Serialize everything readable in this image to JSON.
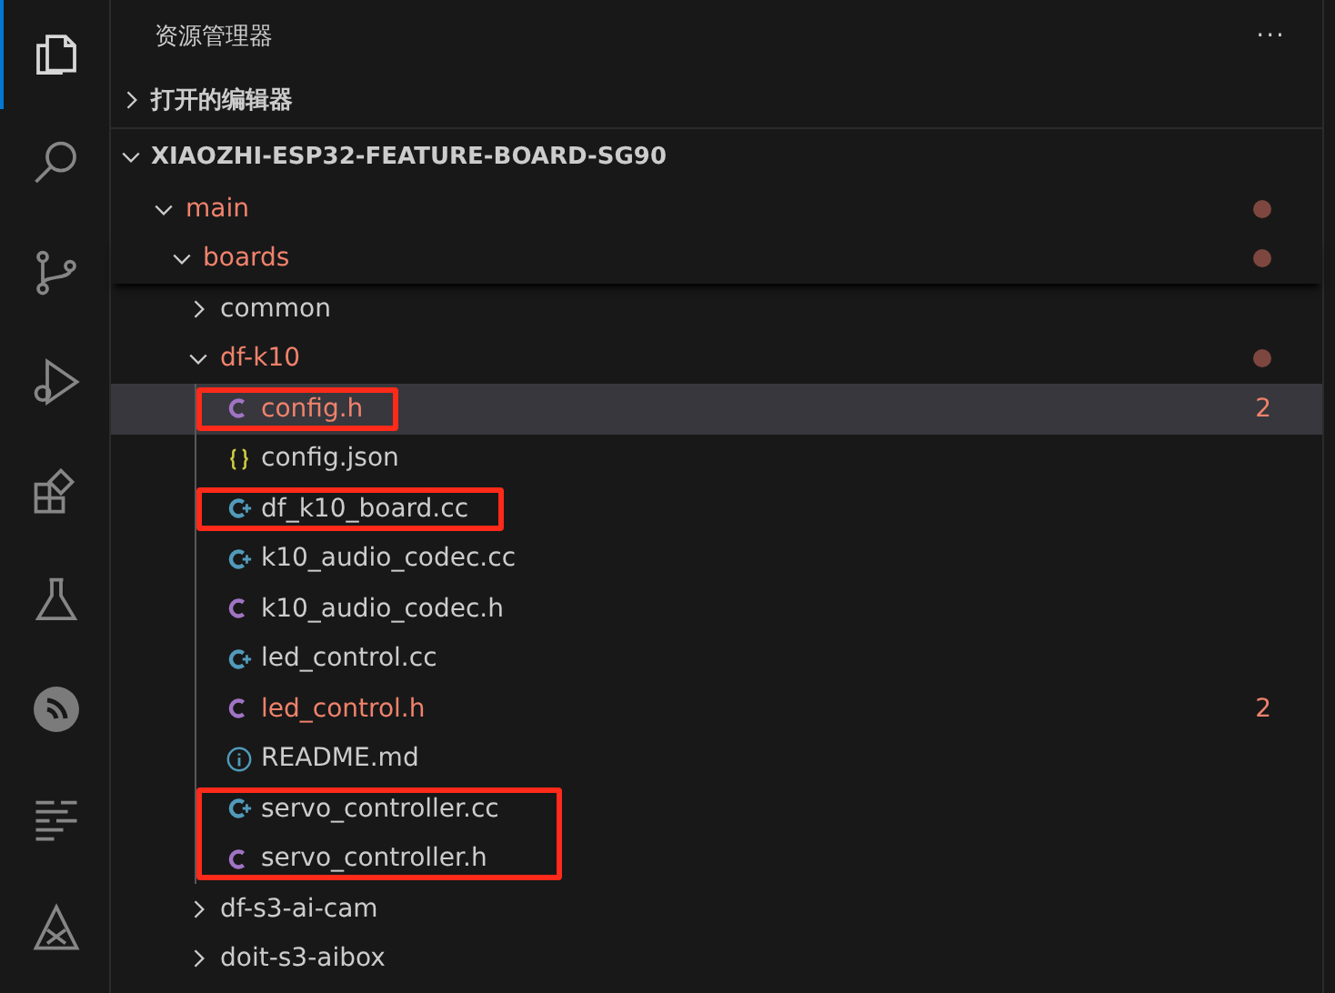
{
  "activity_bar": [
    {
      "kind": "files",
      "selected": true
    },
    {
      "kind": "search",
      "selected": false
    },
    {
      "kind": "branch",
      "selected": false
    },
    {
      "kind": "debug",
      "selected": false
    },
    {
      "kind": "blocks",
      "selected": false
    },
    {
      "kind": "flask",
      "selected": false
    },
    {
      "kind": "signal",
      "selected": false
    },
    {
      "kind": "list",
      "selected": false
    },
    {
      "kind": "triangle",
      "selected": false
    }
  ],
  "explorer": {
    "title": "资源管理器",
    "more": "···",
    "open_editors": {
      "label": "打开的编辑器",
      "expanded": false
    },
    "project": {
      "name": "XIAOZHI-ESP32-FEATURE-BOARD-SG90",
      "expanded": true,
      "children": [
        {
          "name": "main",
          "expanded": true,
          "modified": true,
          "children": [
            {
              "name": "boards",
              "expanded": true,
              "modified": true,
              "children": [
                {
                  "name": "common",
                  "expanded": false,
                  "modified": false
                },
                {
                  "name": "df-k10",
                  "expanded": true,
                  "modified": true,
                  "children": [
                    {
                      "name": "config.h",
                      "kind": "c",
                      "modified": true,
                      "badge": "2",
                      "selected": true,
                      "boxed": true
                    },
                    {
                      "name": "config.json",
                      "kind": "json",
                      "modified": false,
                      "selected": false,
                      "boxed": false
                    },
                    {
                      "name": "df_k10_board.cc",
                      "kind": "cpp",
                      "modified": false,
                      "selected": false,
                      "boxed": true
                    },
                    {
                      "name": "k10_audio_codec.cc",
                      "kind": "cpp",
                      "modified": false,
                      "selected": false,
                      "boxed": false
                    },
                    {
                      "name": "k10_audio_codec.h",
                      "kind": "c",
                      "modified": false,
                      "selected": false,
                      "boxed": false
                    },
                    {
                      "name": "led_control.cc",
                      "kind": "cpp",
                      "modified": false,
                      "selected": false,
                      "boxed": false
                    },
                    {
                      "name": "led_control.h",
                      "kind": "c",
                      "modified": true,
                      "badge": "2",
                      "selected": false,
                      "boxed": false
                    },
                    {
                      "name": "README.md",
                      "kind": "info",
                      "modified": false,
                      "selected": false,
                      "boxed": false
                    },
                    {
                      "name": "servo_controller.cc",
                      "kind": "cpp",
                      "modified": false,
                      "selected": false,
                      "boxed": true
                    },
                    {
                      "name": "servo_controller.h",
                      "kind": "c",
                      "modified": false,
                      "selected": false,
                      "boxed": true
                    }
                  ]
                },
                {
                  "name": "df-s3-ai-cam",
                  "expanded": false,
                  "modified": false
                },
                {
                  "name": "doit-s3-aibox",
                  "expanded": false,
                  "modified": false
                }
              ]
            }
          ]
        }
      ]
    }
  }
}
